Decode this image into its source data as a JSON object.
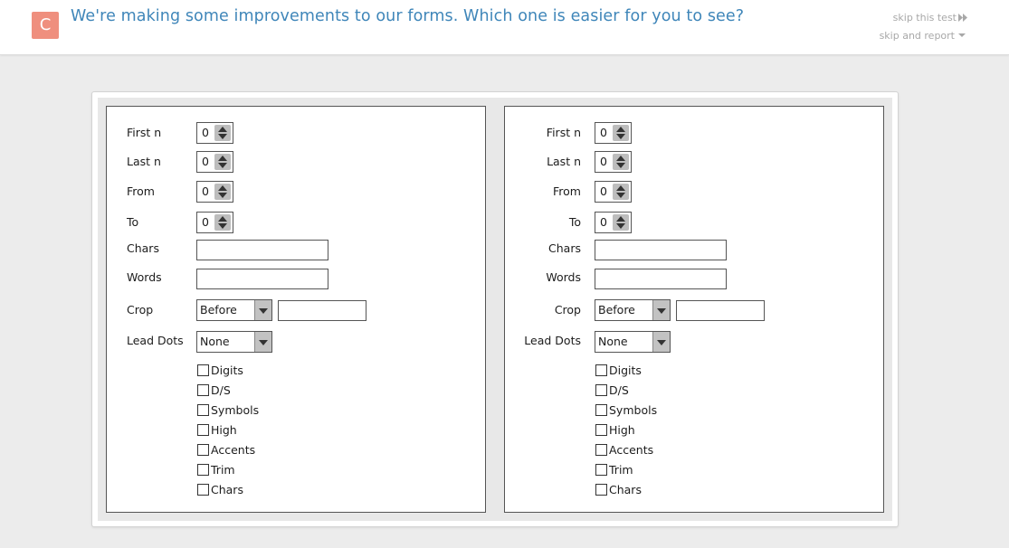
{
  "header": {
    "badge": "C",
    "question": "We're making some improvements to our forms. Which one is easier for you to see?",
    "skip_test": "skip this test",
    "skip_report": "skip and report"
  },
  "form": {
    "labels": {
      "first_n": "First n",
      "last_n": "Last n",
      "from": "From",
      "to": "To",
      "chars": "Chars",
      "words": "Words",
      "crop": "Crop",
      "lead_dots": "Lead Dots"
    },
    "values": {
      "first_n": "0",
      "last_n": "0",
      "from": "0",
      "to": "0",
      "crop": "Before",
      "lead_dots": "None"
    },
    "checkboxes": [
      "Digits",
      "D/S",
      "Symbols",
      "High",
      "Accents",
      "Trim",
      "Chars"
    ]
  }
}
